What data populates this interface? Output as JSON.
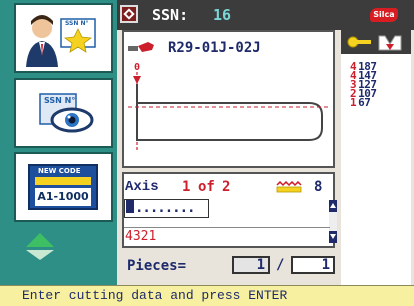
{
  "header": {
    "ssn_label": "SSN:",
    "ssn_value": "16",
    "brand": "Silca"
  },
  "left_panel": {
    "buttons": [
      {
        "name": "user-ssn-button",
        "badge": "SSN N°"
      },
      {
        "name": "view-ssn-button",
        "badge": "SSN N°"
      },
      {
        "name": "new-code-button",
        "title": "NEW CODE",
        "code": "A1-1000"
      }
    ]
  },
  "key_view": {
    "key_code": "R29-01J-02J",
    "marker": "0"
  },
  "cuts": [
    {
      "depth": "4",
      "value": "187"
    },
    {
      "depth": "4",
      "value": "147"
    },
    {
      "depth": "3",
      "value": "127"
    },
    {
      "depth": "2",
      "value": "107"
    },
    {
      "depth": "1",
      "value": "67"
    }
  ],
  "axis_panel": {
    "label": "Axis",
    "current": "1",
    "of": "of",
    "total": "2",
    "cut_count": "8",
    "input_value": "........",
    "code_line": "4321"
  },
  "pieces": {
    "label": "Pieces=",
    "done": "1",
    "separator": "/",
    "total": "1"
  },
  "status": {
    "message": "Enter cutting data and press ENTER"
  },
  "colors": {
    "teal": "#2e8f86",
    "navy": "#1f2a6b",
    "red": "#cc1e2b",
    "status_bg": "#f7f0a0"
  }
}
